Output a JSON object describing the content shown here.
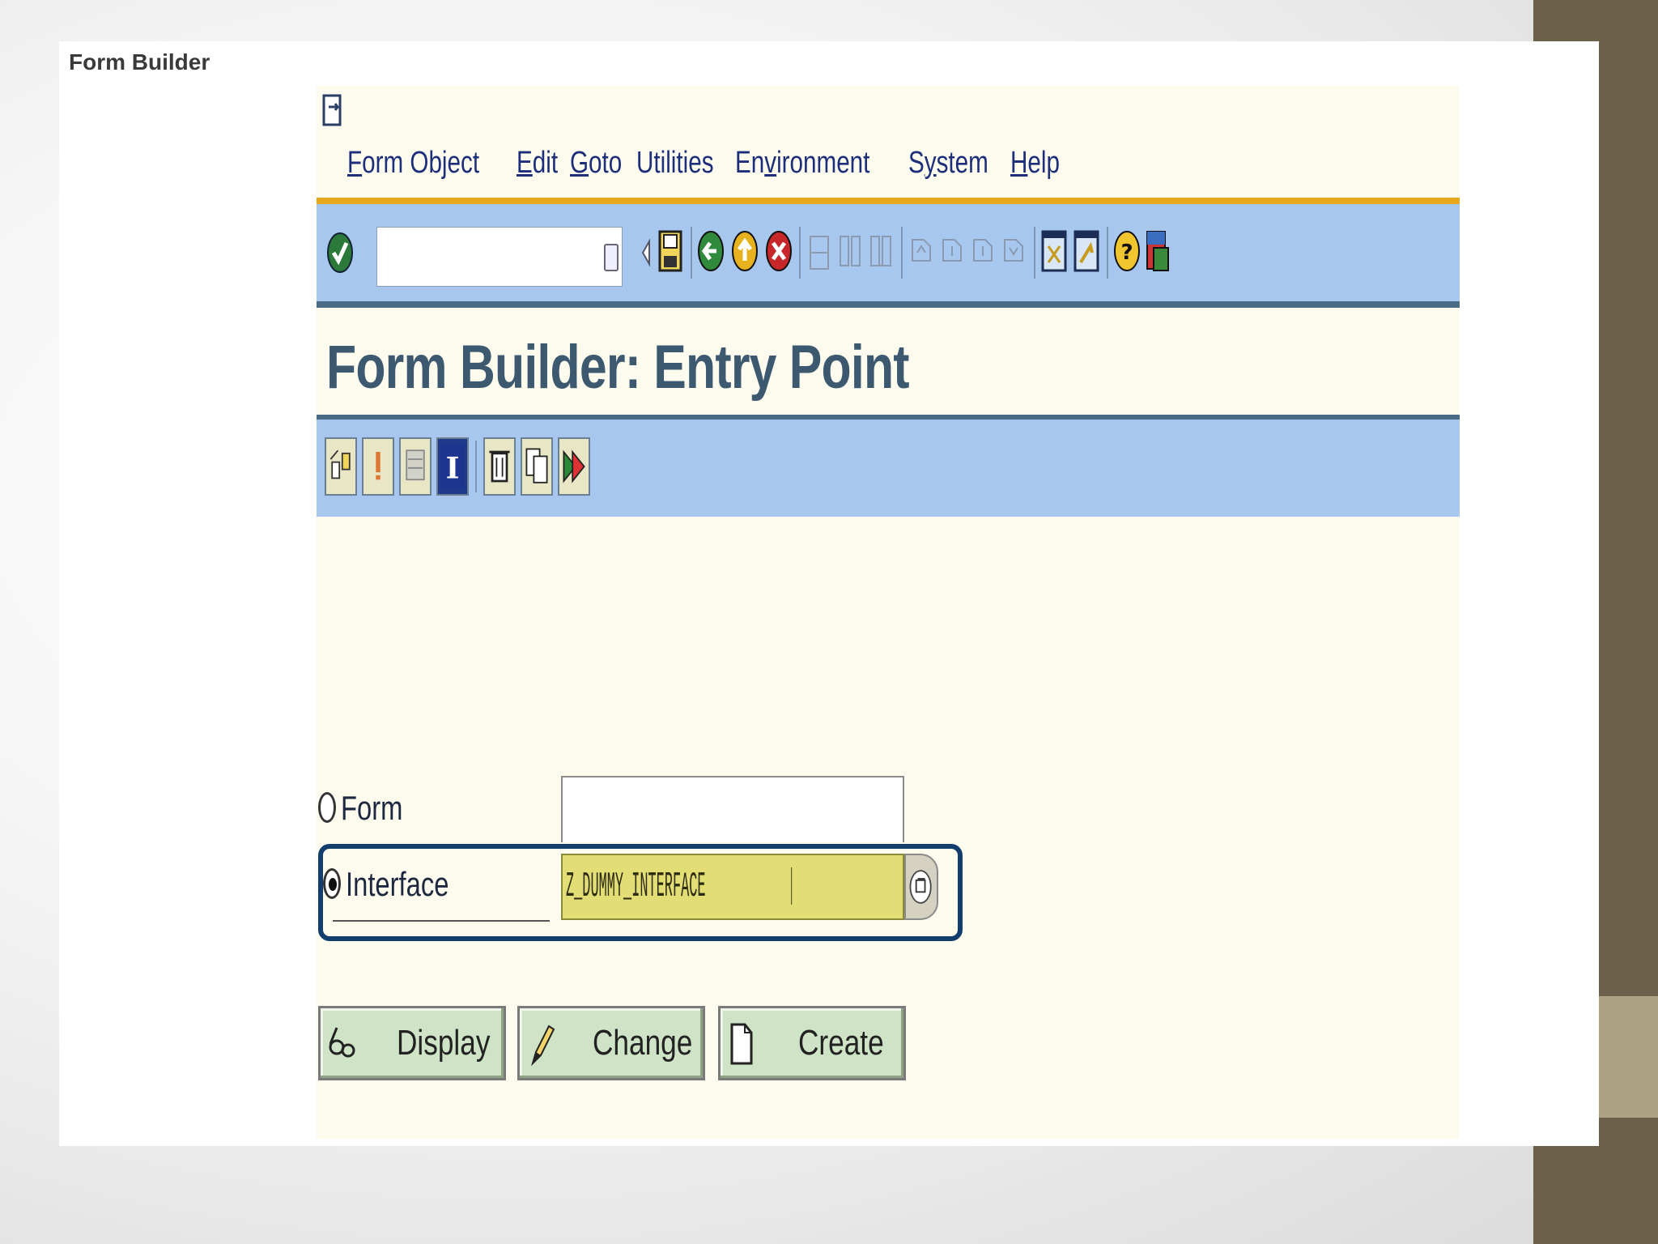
{
  "slide": {
    "title": "Form Builder"
  },
  "menu": [
    {
      "pre": "",
      "u": "F",
      "post": "orm Object"
    },
    {
      "pre": "",
      "u": "E",
      "post": "dit"
    },
    {
      "pre": "",
      "u": "G",
      "post": "oto"
    },
    {
      "pre": "",
      "u": "",
      "post": "Utilities"
    },
    {
      "pre": "En",
      "u": "v",
      "post": "ironment"
    },
    {
      "pre": "S",
      "u": "y",
      "post": "stem"
    },
    {
      "pre": "",
      "u": "H",
      "post": "elp"
    }
  ],
  "command_field": {
    "value": ""
  },
  "page": {
    "title": "Form Builder: Entry Point"
  },
  "fields": {
    "form": {
      "label": "Form",
      "value": "",
      "selected": false
    },
    "interface": {
      "label": "Interface",
      "value": "Z_DUMMY_INTERFACE",
      "selected": true
    }
  },
  "buttons": {
    "display": "Display",
    "change": "Change",
    "create": "Create"
  },
  "icons": {
    "standard_toolbar": [
      "enter-icon",
      "command-dropdown-icon",
      "back-arrow-icon",
      "save-icon",
      "back-icon",
      "exit-icon",
      "cancel-icon",
      "print-icon",
      "find-icon",
      "find-next-icon",
      "first-page-icon",
      "previous-page-icon",
      "next-page-icon",
      "last-page-icon",
      "create-session-icon",
      "shortcut-icon",
      "help-icon",
      "customize-layout-icon"
    ],
    "app_toolbar": [
      "other-object-icon",
      "check-icon",
      "activate-icon",
      "info-icon",
      "delete-icon",
      "copy-icon",
      "execute-icon"
    ]
  },
  "colors": {
    "toolbar_blue": "#a7c7ef",
    "accent_orange": "#e8a81d",
    "title_color": "#3c5970",
    "button_green": "#cfe3c6",
    "input_highlight": "#e2dd74",
    "focus_frame": "#123e6e"
  }
}
